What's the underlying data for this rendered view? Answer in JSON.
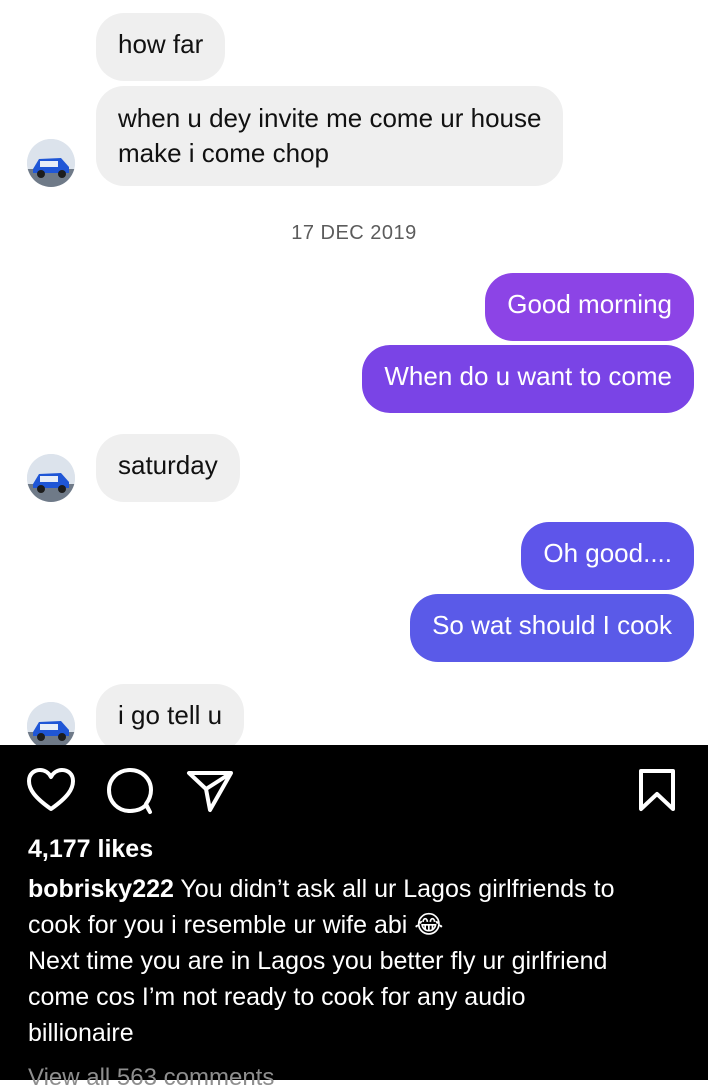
{
  "messages": {
    "m1": "how far",
    "m2_line1": "when u dey invite me come ur house",
    "m2_line2": "make i come chop",
    "date": "17 DEC 2019",
    "m3": "Good morning",
    "m4": "When do u want to come",
    "m5": "saturday",
    "m6": "Oh good....",
    "m7": "So wat should I cook",
    "m8": "i go tell u"
  },
  "colors": {
    "incoming_bubble": "#efefef",
    "outgoing_purple_1": "#8c44e6",
    "outgoing_purple_2": "#7a44e6",
    "outgoing_blue_1": "#5e55ea",
    "outgoing_blue_2": "#5a5ae8"
  },
  "post": {
    "likes": "4,177 likes",
    "username": "bobrisky222",
    "caption_line1": " You didn’t ask all ur Lagos girlfriends to",
    "caption_line2": "cook for you i resemble ur wife abi 😂",
    "caption_line3": "Next time you are in Lagos you better fly ur girlfriend",
    "caption_line4": "come cos I’m not ready to cook for any audio",
    "caption_line5": "billionaire",
    "view_comments": "View all 563 comments"
  },
  "icons": [
    "heart-icon",
    "comment-icon",
    "share-icon",
    "bookmark-icon"
  ]
}
